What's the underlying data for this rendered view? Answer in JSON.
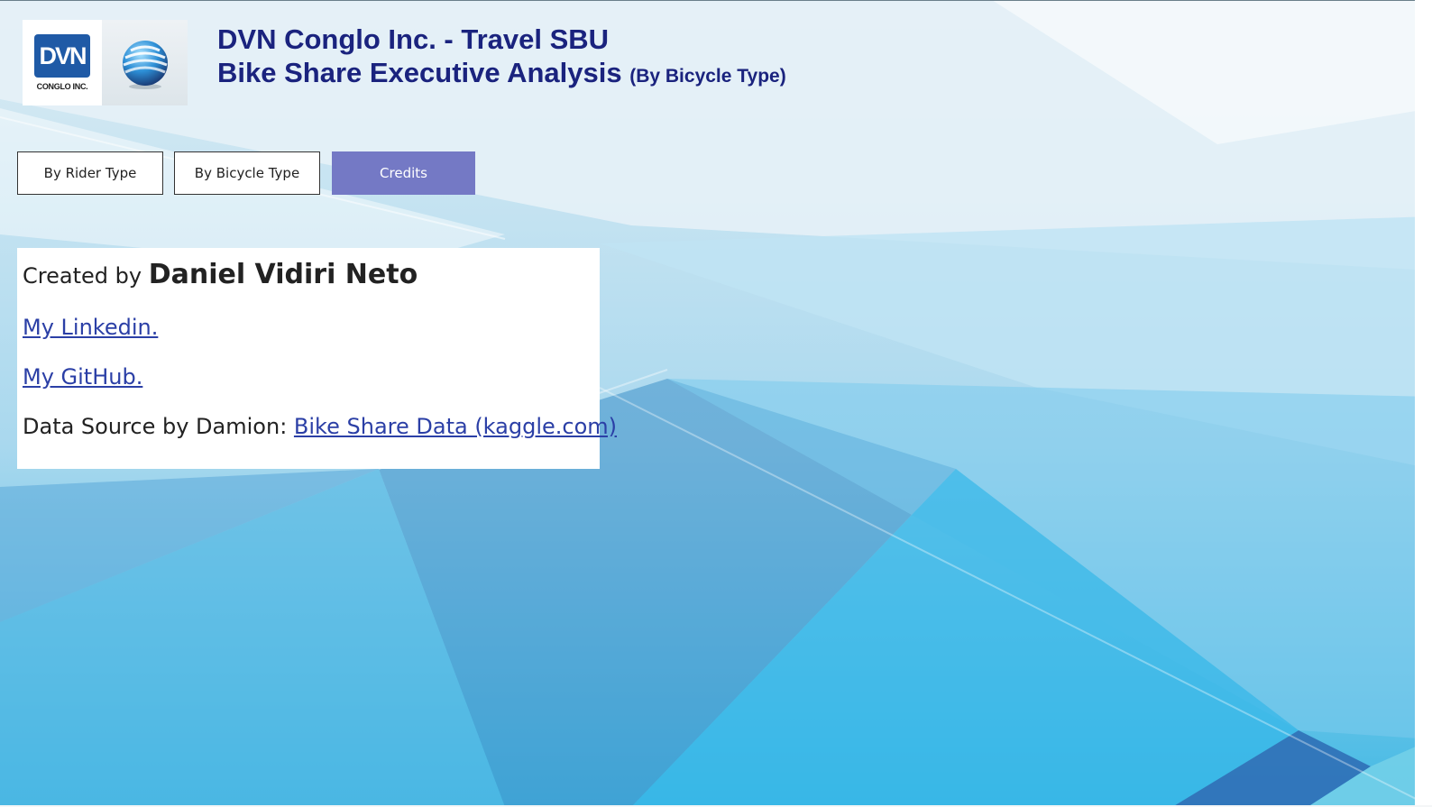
{
  "header": {
    "logo_text": "DVN",
    "logo_subtext": "CONGLO INC.",
    "title_line1": "DVN Conglo Inc. - Travel SBU",
    "title_line2": "Bike Share Executive Analysis",
    "title_suffix": "(By Bicycle Type)"
  },
  "nav": {
    "buttons": [
      {
        "label": "By Rider Type"
      },
      {
        "label": "By Bicycle Type"
      },
      {
        "label": "Credits"
      }
    ]
  },
  "credits": {
    "created_prefix": "Created by",
    "author_name": "Daniel Vidiri Neto",
    "linkedin_label": "My Linkedin.",
    "github_label": "My GitHub.",
    "source_prefix": "Data Source by Damion:",
    "source_link": "Bike Share Data (kaggle.com)"
  },
  "colors": {
    "title": "#1a237e",
    "active_button": "#7479c5",
    "link": "#2b3fa6",
    "logo_blue": "#1f5aa6"
  }
}
